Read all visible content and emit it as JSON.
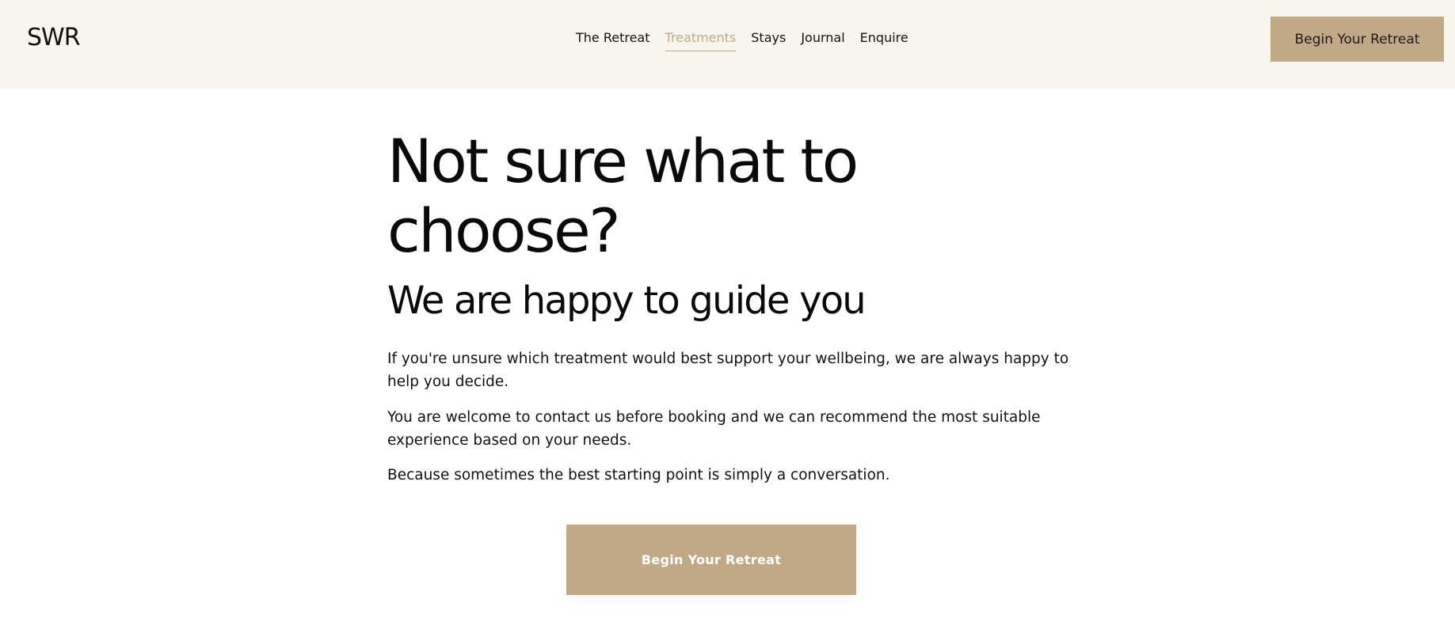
{
  "header": {
    "logo": "SWR",
    "nav": [
      {
        "label": "The Retreat",
        "active": false
      },
      {
        "label": "Treatments",
        "active": true
      },
      {
        "label": "Stays",
        "active": false
      },
      {
        "label": "Journal",
        "active": false
      },
      {
        "label": "Enquire",
        "active": false
      }
    ],
    "cta_label": "Begin Your Retreat"
  },
  "main": {
    "heading": "Not sure what to choose?",
    "subheading": "We are happy to guide you",
    "paragraphs": [
      "If you're unsure which treatment would best support your wellbeing, we are always happy to help you decide.",
      "You are welcome to contact us before booking and we can recommend the most suitable experience based on your needs.",
      "Because sometimes the best starting point is simply a conversation."
    ],
    "cta_label": "Begin Your Retreat"
  },
  "colors": {
    "header_bg": "#f8f5ef",
    "accent": "#c1a988",
    "text": "#111111"
  }
}
